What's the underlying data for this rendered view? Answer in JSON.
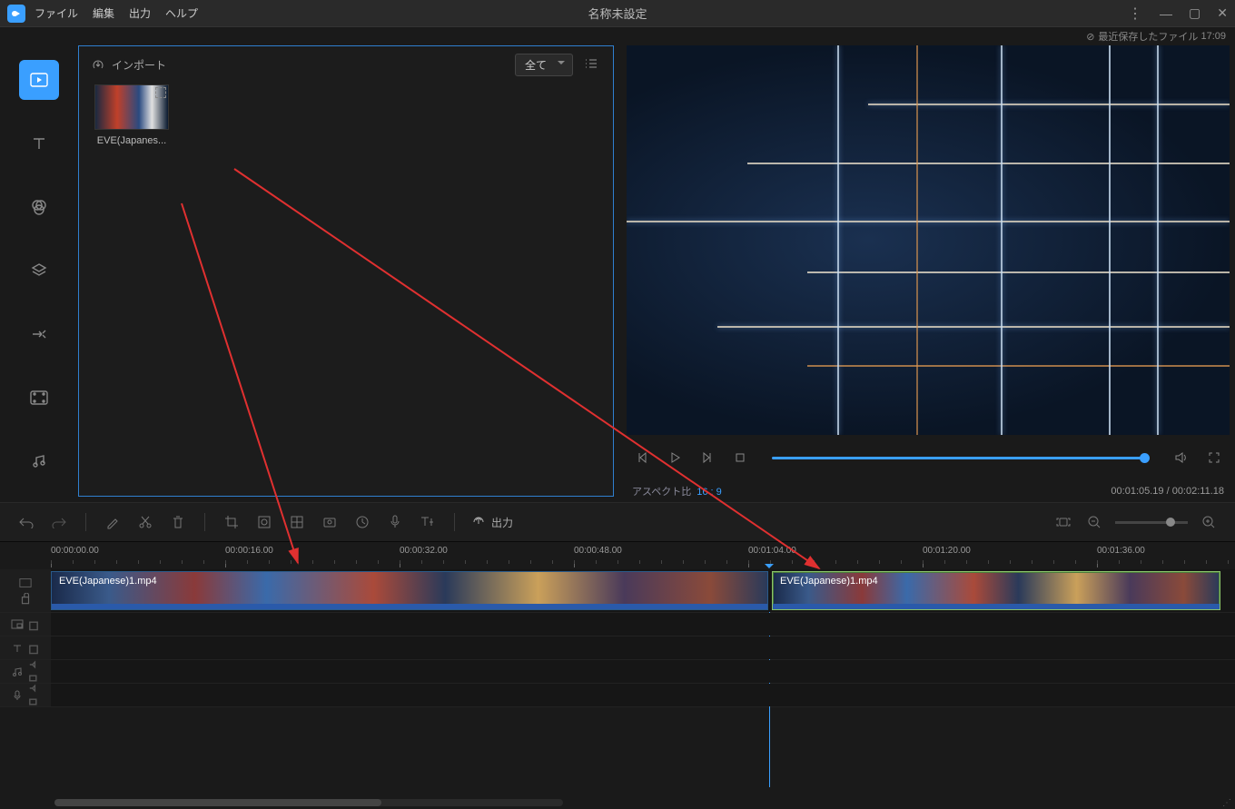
{
  "titlebar": {
    "title": "名称未設定",
    "menus": [
      "ファイル",
      "編集",
      "出力",
      "ヘルプ"
    ]
  },
  "savestrip": {
    "label": "最近保存したファイル",
    "time": "17:09"
  },
  "mediapanel": {
    "import": "インポート",
    "filter": "全て",
    "items": [
      {
        "label": "EVE(Japanes..."
      }
    ]
  },
  "preview": {
    "aspect_label": "アスペクト比",
    "aspect_value": "16 : 9",
    "timecode": "00:01:05.19 / 00:02:11.18"
  },
  "toolbar": {
    "export": "出力"
  },
  "ruler": [
    "00:00:00.00",
    "00:00:16.00",
    "00:00:32.00",
    "00:00:48.00",
    "00:01:04.00",
    "00:01:20.00",
    "00:01:36.00"
  ],
  "clips": [
    {
      "label": "EVE(Japanese)1.mp4"
    },
    {
      "label": "EVE(Japanese)1.mp4"
    }
  ]
}
